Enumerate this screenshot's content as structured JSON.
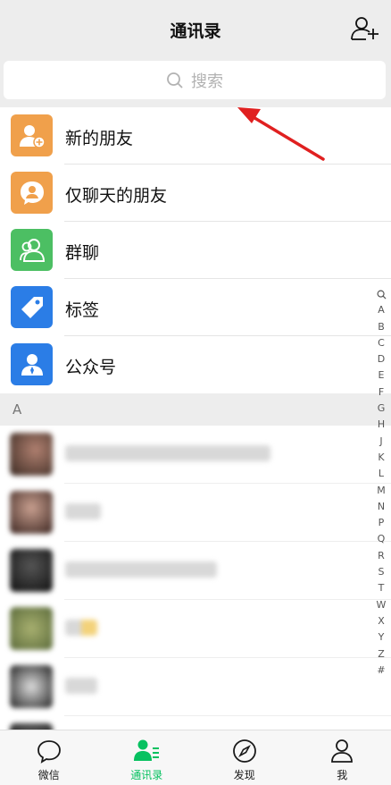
{
  "header": {
    "title": "通讯录",
    "add_icon": "add-contact-icon"
  },
  "search": {
    "placeholder": "搜索",
    "icon": "search-icon"
  },
  "menu": [
    {
      "label": "新的朋友",
      "color": "#f0a04b",
      "icon": "new-friend-icon"
    },
    {
      "label": "仅聊天的朋友",
      "color": "#f0a04b",
      "icon": "chat-only-friend-icon"
    },
    {
      "label": "群聊",
      "color": "#4cbf63",
      "icon": "group-chat-icon"
    },
    {
      "label": "标签",
      "color": "#2b7de6",
      "icon": "tag-icon"
    },
    {
      "label": "公众号",
      "color": "#2b7de6",
      "icon": "official-account-icon"
    }
  ],
  "section": {
    "letter": "A"
  },
  "contacts_note": "blurred",
  "index": [
    "Q",
    "A",
    "B",
    "C",
    "D",
    "E",
    "F",
    "G",
    "H",
    "J",
    "K",
    "L",
    "M",
    "N",
    "P",
    "Q",
    "R",
    "S",
    "T",
    "W",
    "X",
    "Y",
    "Z",
    "#"
  ],
  "tabs": [
    {
      "label": "微信",
      "icon": "chat-bubble-icon",
      "active": false
    },
    {
      "label": "通讯录",
      "icon": "contacts-icon",
      "active": true
    },
    {
      "label": "发现",
      "icon": "compass-icon",
      "active": false
    },
    {
      "label": "我",
      "icon": "person-icon",
      "active": false
    }
  ],
  "colors": {
    "accent": "#07c160",
    "arrow": "#e02020"
  }
}
